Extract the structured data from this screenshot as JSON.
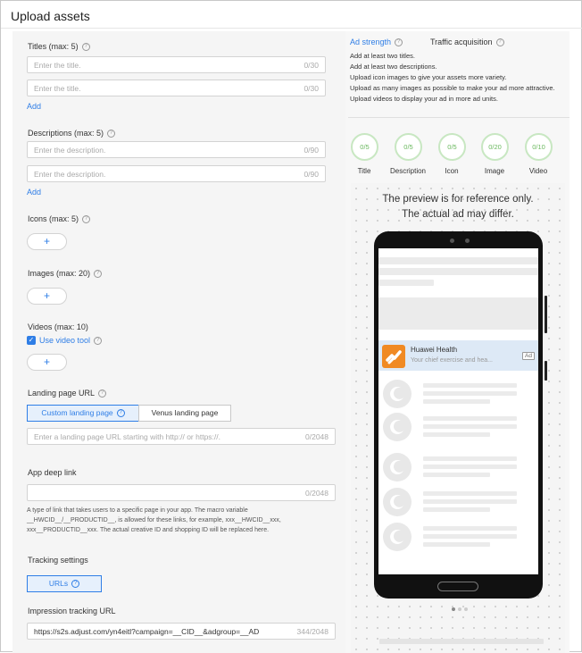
{
  "page": {
    "title": "Upload assets"
  },
  "titles": {
    "label": "Titles (max: 5)",
    "fields": [
      {
        "placeholder": "Enter the title.",
        "count": "0/30"
      },
      {
        "placeholder": "Enter the title.",
        "count": "0/30"
      }
    ],
    "add_label": "Add"
  },
  "descriptions": {
    "label": "Descriptions (max: 5)",
    "fields": [
      {
        "placeholder": "Enter the description.",
        "count": "0/90"
      },
      {
        "placeholder": "Enter the description.",
        "count": "0/90"
      }
    ],
    "add_label": "Add"
  },
  "icons": {
    "label": "Icons (max: 5)",
    "add_symbol": "+"
  },
  "images": {
    "label": "Images (max: 20)",
    "add_symbol": "+"
  },
  "videos": {
    "label": "Videos (max: 10)",
    "use_video_tool_label": "Use video tool",
    "use_video_tool_checked": true,
    "add_symbol": "+"
  },
  "landing_page": {
    "label": "Landing page URL",
    "options": [
      "Custom landing page",
      "Venus landing page"
    ],
    "selected": "Custom landing page",
    "placeholder": "Enter a landing page URL starting with http:// or https://.",
    "count": "0/2048"
  },
  "app_deep_link": {
    "label": "App deep link",
    "count": "0/2048",
    "hint": "A type of link that takes users to a specific page in your app. The macro variable __HWCID__/__PRODUCTID__, is allowed for these links, for example, xxx__HWCID__xxx, xxx__PRODUCTID__xxx. The actual creative ID and shopping ID will be replaced here."
  },
  "tracking": {
    "label": "Tracking settings",
    "urls_button": "URLs",
    "impression_label": "Impression tracking URL",
    "impression_value": "https://s2s.adjust.com/yn4eitl?campaign=__CID__&adgroup=__AD",
    "impression_count": "344/2048"
  },
  "right_panel": {
    "tabs": [
      "Ad strength",
      "Traffic acquisition"
    ],
    "active_tab": "Ad strength",
    "tips": [
      "Add at least two titles.",
      "Add at least two descriptions.",
      "Upload icon images to give your assets more variety.",
      "Upload as many images as possible to make your ad more attractive.",
      "Upload videos to display your ad in more ad units."
    ],
    "progress": [
      {
        "value": "0/5",
        "label": "Title"
      },
      {
        "value": "0/5",
        "label": "Description"
      },
      {
        "value": "0/5",
        "label": "Icon"
      },
      {
        "value": "0/20",
        "label": "Image"
      },
      {
        "value": "0/10",
        "label": "Video"
      }
    ],
    "preview_note_line1": "The preview is for reference only.",
    "preview_note_line2": "The actual ad may differ.",
    "ad": {
      "app_name": "Huawei Health",
      "description": "Your chief exercise and hea...",
      "badge": "Ad"
    },
    "carousel": {
      "pages": 3,
      "active_page": 1
    }
  },
  "colors": {
    "accent": "#2f7ee6",
    "progress_ring": "#c8e7c2",
    "progress_text": "#6ab85e",
    "ad_icon": "#f08a24"
  }
}
